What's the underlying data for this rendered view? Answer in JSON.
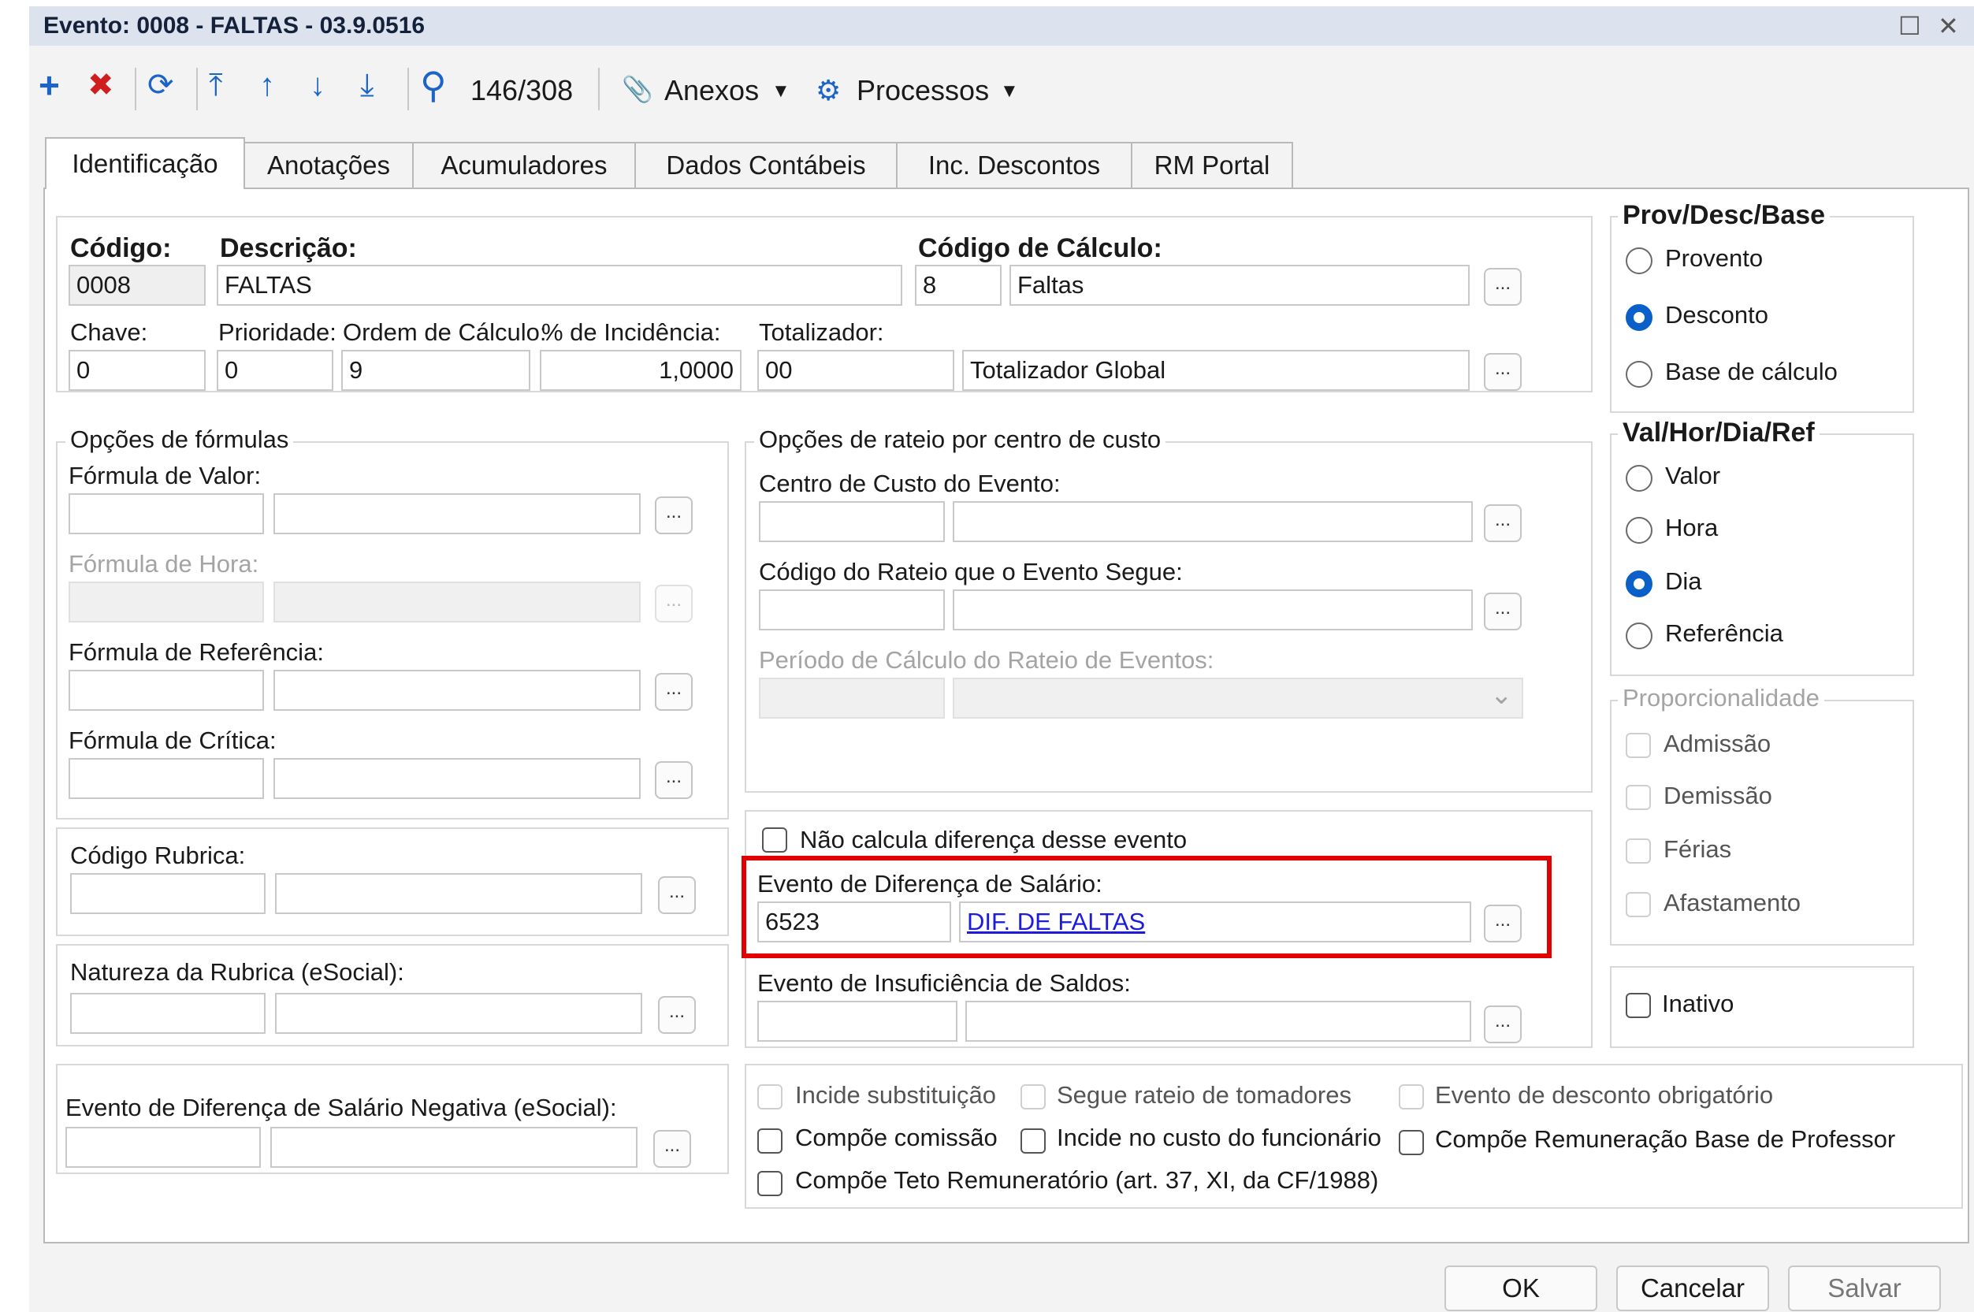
{
  "window": {
    "title": "Evento: 0008 - FALTAS - 03.9.0516",
    "maximize_glyph": "☐",
    "close_glyph": "✕"
  },
  "toolbar": {
    "add_glyph": "+",
    "delete_glyph": "✖",
    "refresh_glyph": "⟳",
    "first_glyph": "⤒",
    "prev_glyph": "↑",
    "next_glyph": "↓",
    "last_glyph": "⤓",
    "search_glyph": "⚲",
    "record_counter": "146/308",
    "attach_glyph": "📎",
    "attachments_label": "Anexos",
    "gear_glyph": "⚙",
    "processes_label": "Processos",
    "dropdown_glyph": "▼"
  },
  "tabs": [
    {
      "label": "Identificação"
    },
    {
      "label": "Anotações"
    },
    {
      "label": "Acumuladores"
    },
    {
      "label": "Dados Contábeis"
    },
    {
      "label": "Inc. Descontos"
    },
    {
      "label": "RM Portal"
    }
  ],
  "form": {
    "codigo_label": "Código:",
    "codigo_value": "0008",
    "descricao_label": "Descrição:",
    "descricao_value": "FALTAS",
    "codigo_calculo_label": "Código de Cálculo:",
    "codigo_calculo_value": "8",
    "codigo_calculo_desc": "Faltas",
    "chave_label": "Chave:",
    "chave_value": "0",
    "prioridade_label": "Prioridade:",
    "prioridade_value": "0",
    "ordem_label": "Ordem de Cálculo:",
    "ordem_value": "9",
    "incidencia_label": "% de Incidência:",
    "incidencia_value": "1,0000",
    "totalizador_label": "Totalizador:",
    "totalizador_value": "00",
    "totalizador_desc": "Totalizador Global",
    "browse_label": "..."
  },
  "formulas": {
    "legend": "Opções de fórmulas",
    "valor_label": "Fórmula de Valor:",
    "hora_label": "Fórmula de Hora:",
    "referencia_label": "Fórmula de Referência:",
    "critica_label": "Fórmula de Crítica:"
  },
  "rubrica": {
    "codigo_label": "Código Rubrica:",
    "natureza_label": "Natureza da Rubrica (eSocial):",
    "dif_negativa_label": "Evento de Diferença de Salário Negativa (eSocial):"
  },
  "rateio": {
    "legend": "Opções de rateio por centro de custo",
    "centro_custo_label": "Centro de Custo do Evento:",
    "codigo_rateio_label": "Código do Rateio que o Evento Segue:",
    "periodo_label": "Período de Cálculo do Rateio de Eventos:",
    "chevron_glyph": "⌄"
  },
  "diferenca": {
    "nao_calcula_label": "Não calcula diferença desse evento",
    "evento_dif_label": "Evento de Diferença de Salário:",
    "evento_dif_code": "6523",
    "evento_dif_desc": "DIF. DE FALTAS",
    "insuficiencia_label": "Evento de Insuficiência de Saldos:"
  },
  "prov_desc_base": {
    "legend": "Prov/Desc/Base",
    "options": [
      "Provento",
      "Desconto",
      "Base de cálculo"
    ],
    "selected": "Desconto"
  },
  "val_hor": {
    "legend": "Val/Hor/Dia/Ref",
    "options": [
      "Valor",
      "Hora",
      "Dia",
      "Referência"
    ],
    "selected": "Dia"
  },
  "proporcionalidade": {
    "legend": "Proporcionalidade",
    "options": [
      "Admissão",
      "Demissão",
      "Férias",
      "Afastamento"
    ]
  },
  "inativo_label": "Inativo",
  "flags": {
    "incide_substituicao": "Incide substituição",
    "segue_rateio": "Segue rateio de tomadores",
    "desconto_obrigatorio": "Evento de desconto obrigatório",
    "compoe_comissao": "Compõe comissão",
    "incide_custo": "Incide no custo do funcionário",
    "compoe_remuneracao": "Compõe Remuneração Base de Professor",
    "compoe_teto": "Compõe Teto Remuneratório (art. 37, XI, da CF/1988)"
  },
  "buttons": {
    "ok": "OK",
    "cancel": "Cancelar",
    "save": "Salvar"
  },
  "colors": {
    "accent": "#0a5fc8",
    "highlight_box": "#e00000",
    "link": "#1c1cdc"
  }
}
